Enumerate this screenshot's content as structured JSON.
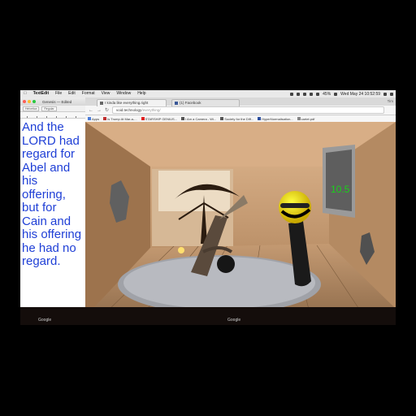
{
  "menubar": {
    "app": "TextEdit",
    "items": [
      "File",
      "Edit",
      "Format",
      "View",
      "Window",
      "Help"
    ],
    "status_text": "Wed May 24 10:52:59",
    "battery": "45%"
  },
  "textedit": {
    "title": "Genesis — Edited",
    "style_select": "Helvetica",
    "weight_select": "Regular",
    "lines": [
      "And the",
      "LORD had",
      "regard for",
      "Abel and",
      "his",
      "offering,",
      "but for",
      "Cain and",
      "his offering",
      "he had no",
      "regard."
    ],
    "text_color": "#1f3fd6"
  },
  "browser": {
    "tabs": [
      {
        "label": "I kinda like everything.right",
        "icon": "page-icon"
      },
      {
        "label": "(1) Facebook",
        "icon": "facebook-icon"
      }
    ],
    "profile": "Tim",
    "url_host": "void.technology",
    "url_path": "/everything/",
    "bookmarks": [
      "Apps",
      "Is Trump At Mar-a-...",
      "STARSHIP GENIUS...",
      "I Am a Camera - Wi...",
      "Society for the Diff...",
      "HyperNormalisation...",
      "cartet.pdf"
    ],
    "score": "10.5"
  },
  "bottom": {
    "labels": [
      "Google",
      "Google"
    ]
  }
}
